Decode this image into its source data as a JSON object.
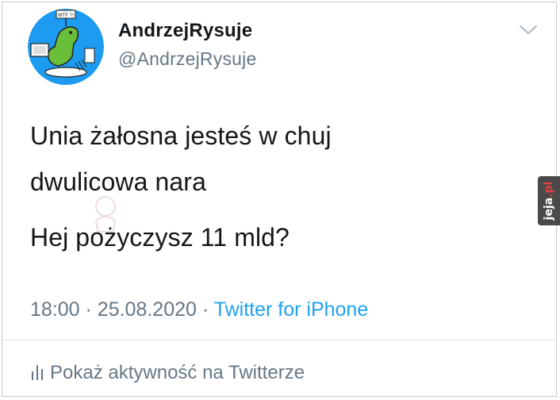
{
  "tweet": {
    "author": {
      "display_name": "AndrzejRysuje",
      "handle": "@AndrzejRysuje",
      "avatar_sign_text": "WTF ?!"
    },
    "text_lines": [
      "Unia żałosna jesteś w chuj",
      "dwulicowa nara",
      "Hej pożyczysz 11 mld?"
    ],
    "time": "18:00",
    "separator": "·",
    "date": "25.08.2020",
    "source": "Twitter for iPhone",
    "activity_label": "Pokaż aktywność na Twitterze"
  },
  "watermark": {
    "site_main": "jeja",
    "site_dot": ".pl"
  },
  "colors": {
    "text": "#14171a",
    "secondary": "#657786",
    "link": "#1da1f2",
    "avatar_bg": "#1d9bf0",
    "avatar_figure": "#6abf3a"
  },
  "icons": {
    "caret": "chevron-down-icon",
    "activity": "bar-chart-icon"
  }
}
